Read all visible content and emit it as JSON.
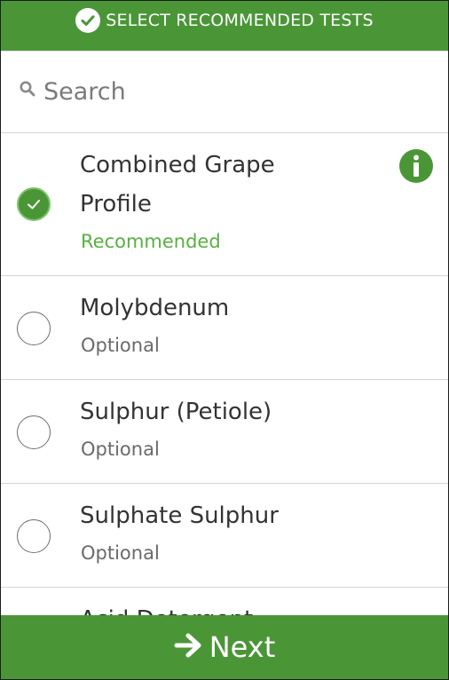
{
  "header": {
    "title": "SELECT RECOMMENDED TESTS",
    "icon": "check-circle-icon"
  },
  "search": {
    "placeholder": "Search",
    "icon": "search-icon"
  },
  "tests": [
    {
      "name_line1": "Combined Grape",
      "name_line2": "Profile",
      "status": "Recommended",
      "selected": true,
      "info_icon": "info-icon"
    },
    {
      "name": "Molybdenum",
      "status": "Optional",
      "selected": false
    },
    {
      "name": "Sulphur (Petiole)",
      "status": "Optional",
      "selected": false
    },
    {
      "name": "Sulphate Sulphur",
      "status": "Optional",
      "selected": false
    },
    {
      "name": "Acid Detergent",
      "status": "",
      "selected": false
    }
  ],
  "footer": {
    "next_label": "Next",
    "icon": "arrow-right-icon"
  },
  "colors": {
    "brand_green": "#4a9637",
    "recommended_green": "#58b041"
  }
}
